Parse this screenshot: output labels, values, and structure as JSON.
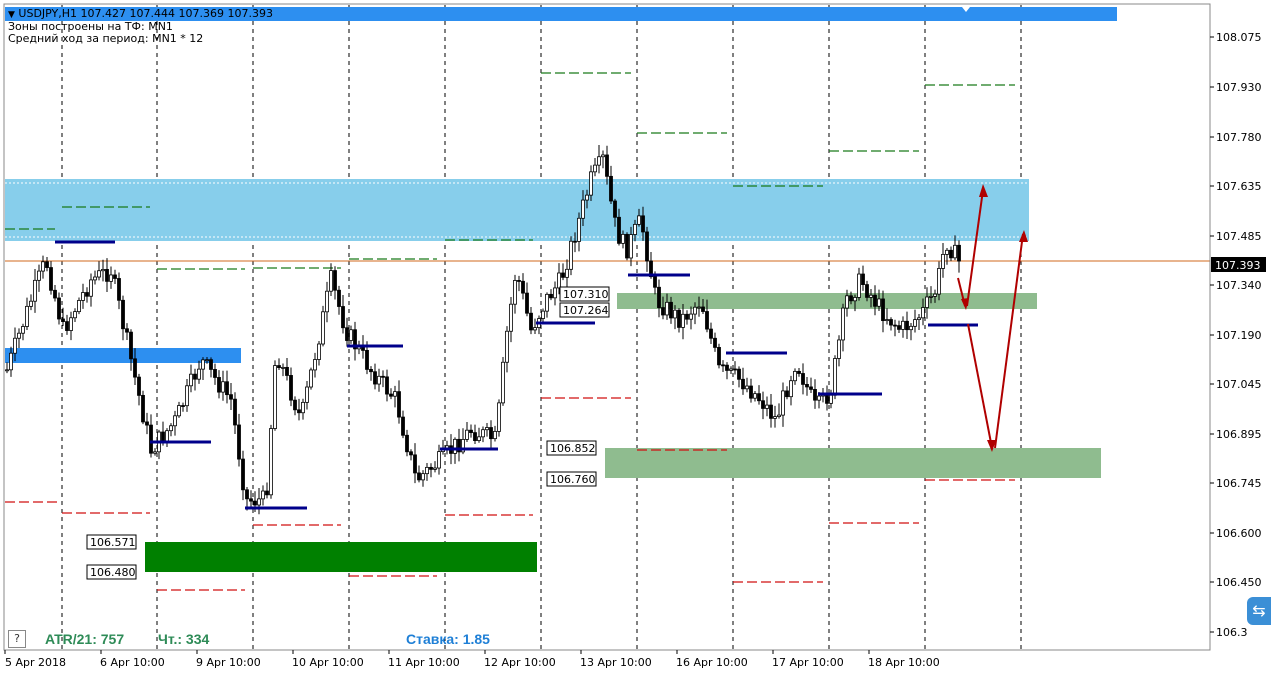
{
  "header": {
    "symbol_line": "USDJPY,H1  107.427 107.444 107.369 107.393",
    "zones_line": "Зоны построены на ТФ: MN1",
    "avg_line": "Средний ход за период: MN1 * 12",
    "menu_icon": "triangle-down-icon"
  },
  "price_axis": {
    "ticks": [
      "108.075",
      "107.930",
      "107.780",
      "107.635",
      "107.485",
      "107.340",
      "107.190",
      "107.045",
      "106.895",
      "106.745",
      "106.600",
      "106.450",
      "106.3"
    ],
    "current_price": "107.393",
    "current_price_color": "#000000"
  },
  "time_axis": {
    "labels": [
      "5 Apr 2018",
      "6 Apr 10:00",
      "9 Apr 10:00",
      "10 Apr 10:00",
      "11 Apr 10:00",
      "12 Apr 10:00",
      "13 Apr 10:00",
      "16 Apr 10:00",
      "17 Apr 10:00",
      "18 Apr 10:00"
    ]
  },
  "zone_labels": {
    "z1_top": "107.310",
    "z1_bottom": "107.264",
    "z2_top": "106.852",
    "z2_bottom": "106.760",
    "z3_top": "106.571",
    "z3_bottom": "106.480"
  },
  "stats": {
    "atr": "ATR/21: 757",
    "count": "Чт.: 334",
    "rate": "Ставка: 1.85"
  },
  "help_button": "?",
  "colors": {
    "blue_zone": "#87ceeb",
    "blue_bar": "#2d8ff0",
    "green_zone": "#8fbc8f",
    "dark_green_zone": "#008000",
    "arrow": "#b00000",
    "price_line": "#d2691e"
  }
}
